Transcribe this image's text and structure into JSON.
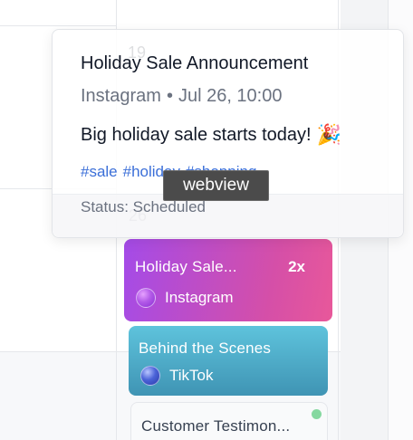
{
  "calendar": {
    "day_numbers": [
      "19",
      "26"
    ]
  },
  "popover": {
    "title": "Holiday Sale Announcement",
    "platform": "Instagram",
    "separator": "•",
    "datetime": "Jul 26, 10:00",
    "body": "Big holiday sale starts today!",
    "body_icon": "party-popper-icon",
    "hashtags": [
      "#sale",
      "#holiday",
      "#shopping"
    ],
    "status": "Status: Scheduled"
  },
  "tooltip": {
    "text": "webview"
  },
  "events": [
    {
      "title": "Holiday Sale...",
      "count": "2x",
      "platform": "Instagram",
      "platform_icon": "instagram-dot-icon",
      "color": "#b84fd0"
    },
    {
      "title": "Behind the Scenes",
      "platform": "TikTok",
      "platform_icon": "tiktok-dot-icon",
      "color": "#4aa8c8"
    },
    {
      "title": "Customer Testimon...",
      "status_color": "#86d8a0"
    }
  ]
}
